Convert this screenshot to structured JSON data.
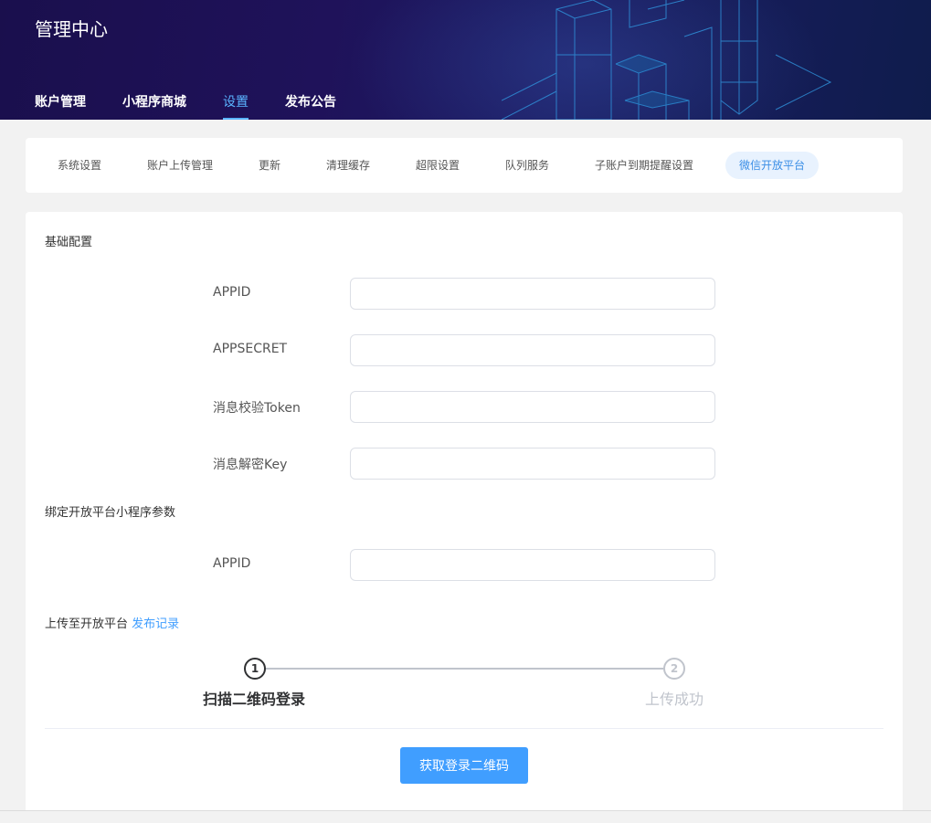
{
  "header": {
    "title": "管理中心",
    "nav": [
      "账户管理",
      "小程序商城",
      "设置",
      "发布公告"
    ],
    "active_nav": "设置"
  },
  "sub_tabs": {
    "items": [
      "系统设置",
      "账户上传管理",
      "更新",
      "清理缓存",
      "超限设置",
      "队列服务",
      "子账户到期提醒设置",
      "微信开放平台"
    ],
    "active": "微信开放平台"
  },
  "basic_config": {
    "title": "基础配置",
    "fields": [
      {
        "label": "APPID",
        "value": ""
      },
      {
        "label": "APPSECRET",
        "value": ""
      },
      {
        "label": "消息校验Token",
        "value": ""
      },
      {
        "label": "消息解密Key",
        "value": ""
      }
    ]
  },
  "bind_config": {
    "title": "绑定开放平台小程序参数",
    "fields": [
      {
        "label": "APPID",
        "value": ""
      }
    ]
  },
  "upload": {
    "title": "上传至开放平台",
    "link": "发布记录",
    "steps": [
      {
        "number": "1",
        "title": "扫描二维码登录",
        "status": "done"
      },
      {
        "number": "2",
        "title": "上传成功",
        "status": "pending"
      }
    ],
    "button": "获取登录二维码"
  },
  "colors": {
    "primary": "#409eff",
    "active_nav": "#5ab4ff",
    "active_tab_bg": "#e8f2fe",
    "header_bg": "#1b1458"
  }
}
